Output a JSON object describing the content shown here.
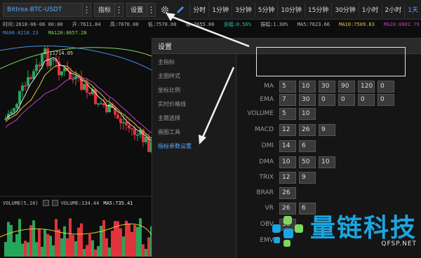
{
  "toolbar": {
    "market": "Bittrex-BTC-USDT",
    "indicator": "指标",
    "settings": "设置",
    "periods": [
      "分时",
      "1分钟",
      "3分钟",
      "5分钟",
      "10分钟",
      "15分钟",
      "30分钟",
      "1小时",
      "2小时",
      "1天"
    ],
    "active_period_index": 9
  },
  "info": {
    "time": "时间:2018-06-06 00:00",
    "open": "开:7611.84",
    "high": "高:7670.00",
    "low": "低:7570.00",
    "close": "收:7655.00",
    "change": "涨幅:0.56%",
    "amplitude": "振幅:1.30%",
    "ma5": "MA5:7623.66",
    "ma10": "MA10:7509.83",
    "ma20": "MA20:0002.79",
    "ma90": "MA90:8218.23",
    "ma120": "MA120:8657.28"
  },
  "chart": {
    "max_price_label": "← 11714.05",
    "volume_label": "VOLUME(5,10)",
    "volume_value": "VOLUME:134.44",
    "volume_ma5": "MA5:735.41",
    "colors": {
      "up": "#26a65b",
      "down": "#e0333c",
      "ma5": "#e6e6e6",
      "ma10": "#e6c832",
      "ma20": "#c040c0",
      "ma90": "#4a90e2",
      "ma120": "#7ed957"
    }
  },
  "dialog": {
    "title": "设置",
    "menu": [
      "主指标",
      "主图样式",
      "坐标比例",
      "实时价格线",
      "主题选择",
      "画图工具",
      "指标参数设置"
    ],
    "active_menu_index": 6,
    "params": [
      {
        "name": "MA",
        "values": [
          "5",
          "10",
          "30",
          "90",
          "120",
          "0"
        ]
      },
      {
        "name": "EMA",
        "values": [
          "7",
          "30",
          "0",
          "0",
          "0",
          "0"
        ]
      },
      {
        "name": "VOLUME",
        "values": [
          "5",
          "10"
        ]
      },
      {
        "name": "MACD",
        "values": [
          "12",
          "26",
          "9"
        ]
      },
      {
        "name": "DMI",
        "values": [
          "14",
          "6"
        ]
      },
      {
        "name": "DMA",
        "values": [
          "10",
          "50",
          "10"
        ]
      },
      {
        "name": "TRIX",
        "values": [
          "12",
          "9"
        ]
      },
      {
        "name": "BRAR",
        "values": [
          "26"
        ]
      },
      {
        "name": "VR",
        "values": [
          "26",
          "6"
        ]
      },
      {
        "name": "OBV",
        "values": [
          "30"
        ]
      },
      {
        "name": "EMV",
        "values": []
      }
    ]
  },
  "watermark": {
    "cn": "量链科技",
    "en": "QFSP.NET"
  }
}
